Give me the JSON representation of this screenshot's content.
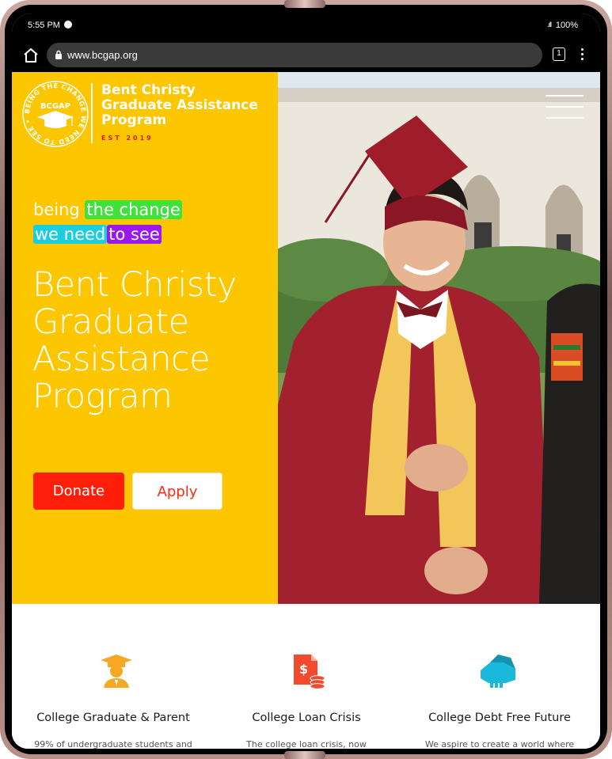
{
  "status_bar": {
    "time": "5:55 PM",
    "battery": "100%"
  },
  "browser": {
    "url": "www.bcgap.org",
    "tab_count": "1"
  },
  "logo": {
    "seal_text": "BEING THE CHANGE WE NEED TO SEE •",
    "seal_acronym": "BCGAP",
    "title_line1": "Bent Christy",
    "title_line2": "Graduate Assistance",
    "title_line3": "Program",
    "est": "EST 2019"
  },
  "hero": {
    "tagline": {
      "word1": "being",
      "word2": "the change",
      "word3": "we need",
      "word4": "to see"
    },
    "heading_line1": "Bent Christy",
    "heading_line2": "Graduate",
    "heading_line3": "Assistance",
    "heading_line4": "Program",
    "donate_label": "Donate",
    "apply_label": "Apply"
  },
  "features": [
    {
      "icon": "graduate-icon",
      "title": "College Graduate & Parent",
      "desc": "99% of undergraduate students and"
    },
    {
      "icon": "invoice-dollar-icon",
      "title": "College Loan Crisis",
      "desc": "The college loan crisis, now"
    },
    {
      "icon": "handshake-icon",
      "title": "College Debt Free Future",
      "desc": "We aspire to create a world where"
    }
  ],
  "colors": {
    "brand_yellow": "#fcc600",
    "donate_red": "#ff1e0a",
    "highlight_green": "#3ee23a",
    "highlight_cyan": "#1ccde0",
    "highlight_purple": "#9a18f0",
    "icon_orange": "#f7a823",
    "icon_red": "#f24a2c",
    "icon_cyan": "#1ab9dc"
  }
}
